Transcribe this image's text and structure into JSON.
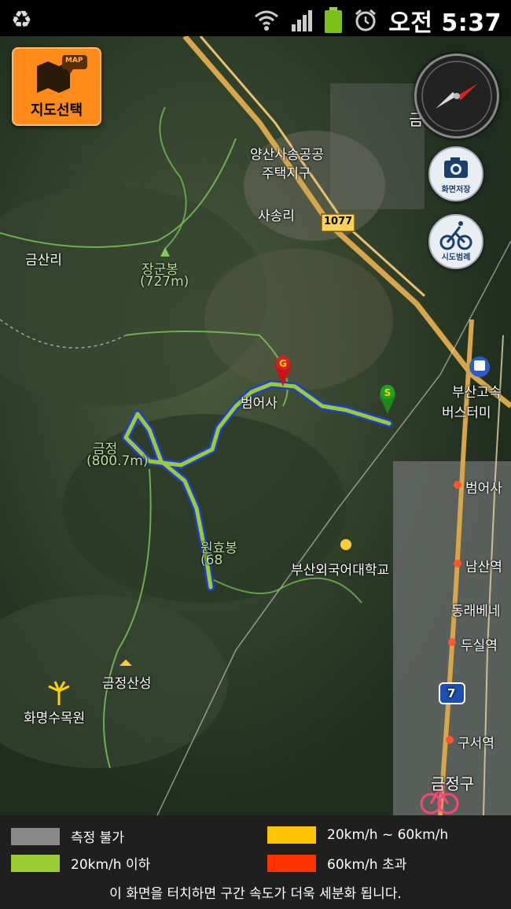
{
  "status": {
    "time": "오전 5:37",
    "icons": [
      "recycle-icon",
      "wifi-icon",
      "signal-icon",
      "battery-icon",
      "alarm-icon"
    ]
  },
  "map": {
    "select_button": "지도선택",
    "select_badge": "MAP",
    "save_screen": "화면저장",
    "bike_route": "시도범례",
    "labels": {
      "apartment": "양산사송공공",
      "apartment2": "주택지구",
      "sasong": "사송리",
      "road1077": "1077",
      "geumsanri": "금산리",
      "janggunbong": "장군봉",
      "janggun_h": "(727m)",
      "beomeosa": "범어사",
      "geumjeong": "금정",
      "geumjeong_h": "(800.7m)",
      "wonhyobong": "원효봉",
      "wonhyo_h": "(68",
      "buseonuniv": "부산외국어대학교",
      "busterminal": "부산고속",
      "busterminal2": "버스터미",
      "beomeosa_st": "범어사",
      "namsan_st": "남산역",
      "dongnae": "동래베네",
      "dusil_st": "두실역",
      "road7": "7",
      "guseo_st": "구서역",
      "geumjeongsanseong": "금정산성",
      "hwamyeong": "화명수목원",
      "geumjeonggu": "금정구",
      "top_label": "금산"
    }
  },
  "legend": {
    "items": [
      {
        "label": "측정 불가",
        "color": "#8a8a8a"
      },
      {
        "label": "20km/h ~ 60km/h",
        "color": "#ffc400"
      },
      {
        "label": "20km/h 이하",
        "color": "#9acd32"
      },
      {
        "label": "60km/h 초과",
        "color": "#ff3300"
      }
    ],
    "note": "이 화면을 터치하면 구간 속도가 더욱 세분화 됩니다."
  }
}
